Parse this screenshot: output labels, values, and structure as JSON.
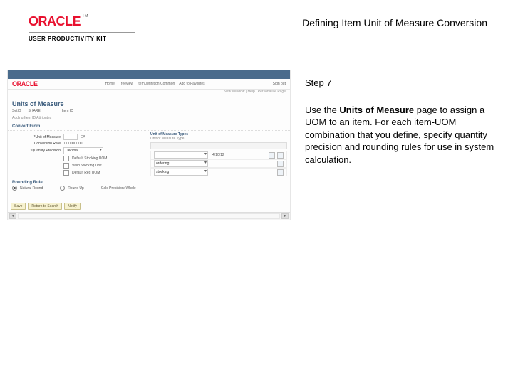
{
  "logo": {
    "brand": "ORACLE",
    "tm": "TM",
    "subtitle": "USER PRODUCTIVITY KIT"
  },
  "title": "Defining Item Unit of Measure Conversion",
  "step": "Step 7",
  "body_prefix": "Use the ",
  "body_bold": "Units of Measure",
  "body_suffix": " page to assign a UOM to an item. For each item-UOM combination that you define, specify quantity precision and rounding rules for use in system calculation.",
  "screenshot": {
    "oracle": "ORACLE",
    "tabs": [
      "Home",
      "Treeview",
      "ItemDefinition Common",
      "Add to Favorites"
    ],
    "signout": "Sign out",
    "sub_row": "New Window | Help | Personalize Page",
    "heading": "Units of Measure",
    "setid_label": "SetID",
    "setid_value": "SHARE",
    "itemid_label": "Item ID",
    "form_sub": "Adding Item ID Attributes",
    "uom_hint": "Unit of Measure Types",
    "convert_section": "Convert From",
    "f_uom": "*Unit of Measure",
    "f_uom_val": "EA",
    "f_qty": "*Quantity Precision",
    "f_qty_val": "Decimal",
    "f_conv": "Conversion Rate",
    "f_conv_val": "1.00000000",
    "chk1": "Default Stocking UOM",
    "chk2": "Valid Stocking Unit",
    "chk3": "Default Req UOM",
    "uot_header": "Unit of Measure Types",
    "uot_hint": "Unit of Measure Type",
    "date_cell": "4/10/12",
    "dd_ordering": "ordering",
    "dd_stocking": "stocking",
    "round_header": "Rounding Rule",
    "round_opt1": "Natural Round",
    "round_opt2": "Round Up",
    "round_opt3": "Calc Precision: Whole",
    "buttons": [
      "Save",
      "Return to Search",
      "Notify"
    ]
  }
}
